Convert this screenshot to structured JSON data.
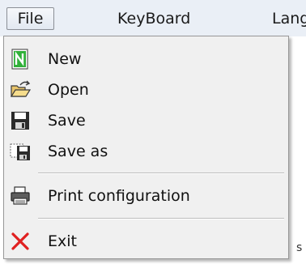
{
  "menubar": {
    "items": [
      {
        "label": "File"
      },
      {
        "label": "KeyBoard"
      },
      {
        "label": "Lang"
      }
    ]
  },
  "file_menu": {
    "items": [
      {
        "label": "New",
        "icon": "new-document-icon"
      },
      {
        "label": "Open",
        "icon": "open-folder-icon"
      },
      {
        "label": "Save",
        "icon": "save-disk-icon"
      },
      {
        "label": "Save as",
        "icon": "save-as-icon"
      },
      {
        "label": "Print configuration",
        "icon": "printer-icon"
      },
      {
        "label": "Exit",
        "icon": "exit-x-icon"
      }
    ]
  },
  "colors": {
    "menubar_bg": "#eaeff6",
    "menu_bg": "#f0f0f0",
    "exit_red": "#e02020",
    "new_green": "#2fa82f"
  }
}
